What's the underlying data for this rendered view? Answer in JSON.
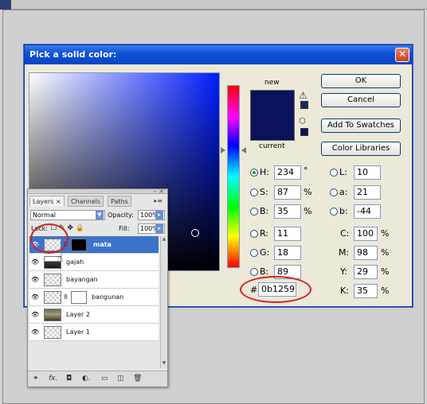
{
  "dialog": {
    "title": "Pick a solid color:",
    "close_glyph": "✕",
    "label_new": "new",
    "label_current": "current",
    "buttons": {
      "ok": "OK",
      "cancel": "Cancel",
      "add_to_swatches": "Add To Swatches",
      "color_libraries": "Color Libraries"
    },
    "hsb": {
      "h": {
        "label": "H:",
        "value": "234",
        "unit": "°"
      },
      "s": {
        "label": "S:",
        "value": "87",
        "unit": "%"
      },
      "b": {
        "label": "B:",
        "value": "35",
        "unit": "%"
      }
    },
    "rgb": {
      "r": {
        "label": "R:",
        "value": "11"
      },
      "g": {
        "label": "G:",
        "value": "18"
      },
      "b": {
        "label": "B:",
        "value": "89"
      }
    },
    "lab": {
      "l": {
        "label": "L:",
        "value": "10"
      },
      "a": {
        "label": "a:",
        "value": "21"
      },
      "b": {
        "label": "b:",
        "value": "-44"
      }
    },
    "cmyk": {
      "c": {
        "label": "C:",
        "value": "100",
        "unit": "%"
      },
      "m": {
        "label": "M:",
        "value": "98",
        "unit": "%"
      },
      "y": {
        "label": "Y:",
        "value": "29",
        "unit": "%"
      },
      "k": {
        "label": "K:",
        "value": "35",
        "unit": "%"
      }
    },
    "hex": {
      "label": "#",
      "value": "0b1259"
    },
    "colors": {
      "picked": "#0b1259",
      "accent_circle": "#d42020"
    }
  },
  "layers_panel": {
    "tabs": [
      "Layers ×",
      "Channels",
      "Paths"
    ],
    "blend_mode": "Normal",
    "opacity_label": "Opacity:",
    "opacity_value": "100%",
    "lock_label": "Lock:",
    "fill_label": "Fill:",
    "fill_value": "100%",
    "layers": [
      {
        "name": "mata",
        "selected": true
      },
      {
        "name": "gajah",
        "selected": false
      },
      {
        "name": "bayangan",
        "selected": false
      },
      {
        "name": "bangunan",
        "selected": false
      },
      {
        "name": "Layer 2",
        "selected": false
      },
      {
        "name": "Layer 1",
        "selected": false
      }
    ],
    "bottom_icons": [
      "link-icon",
      "fx-icon",
      "mask-icon",
      "adjustment-icon",
      "folder-icon",
      "new-layer-icon",
      "trash-icon"
    ]
  }
}
